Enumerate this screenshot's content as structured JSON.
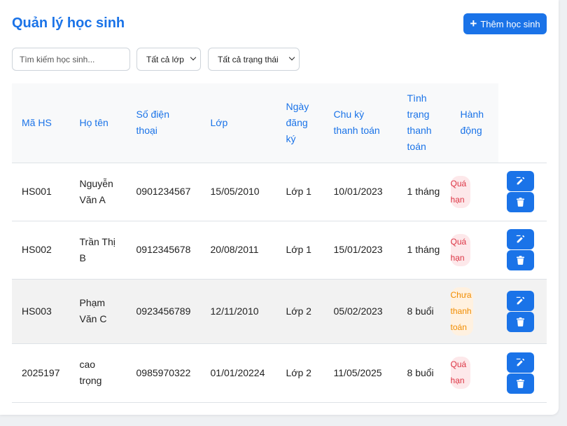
{
  "header": {
    "title": "Quản lý học sinh",
    "add_button_label": "Thêm học sinh"
  },
  "filters": {
    "search_placeholder": "Tìm kiếm học sinh...",
    "class_select": "Tất cả lớp",
    "status_select": "Tất cả trạng thái"
  },
  "table": {
    "headers": {
      "id": "Mã HS",
      "name": "Họ tên",
      "phone": "Số điện thoại",
      "class_col": "Lớp",
      "registered": "Ngày đăng ký",
      "cycle": "Chu kỳ thanh toán",
      "payment_status": "Tình trạng thanh toán",
      "action": "Hành động"
    },
    "rows": [
      {
        "id": "HS001",
        "name": "Nguyễn Văn A",
        "phone": "0901234567",
        "dob": "15/05/2010",
        "class_name": "Lớp 1",
        "registered": "10/01/2023",
        "cycle": "1 tháng",
        "status": "Quá hạn"
      },
      {
        "id": "HS002",
        "name": "Trần Thị B",
        "phone": "0912345678",
        "dob": "20/08/2011",
        "class_name": "Lớp 1",
        "registered": "15/01/2023",
        "cycle": "1 tháng",
        "status": "Quá hạn"
      },
      {
        "id": "HS003",
        "name": "Phạm Văn C",
        "phone": "0923456789",
        "dob": "12/11/2010",
        "class_name": "Lớp 2",
        "registered": "05/02/2023",
        "cycle": "8 buổi",
        "status": "Chưa thanh toán"
      },
      {
        "id": "2025197",
        "name": "cao trọng",
        "phone": "0985970322",
        "dob": "01/01/20224",
        "class_name": "Lớp 2",
        "registered": "11/05/2025",
        "cycle": "8 buổi",
        "status": "Quá hạn"
      }
    ]
  },
  "colors": {
    "primary": "#1a73e8",
    "overdue_text": "#dc3545",
    "overdue_bg": "#fde8ea",
    "unpaid_text": "#f08c00",
    "unpaid_bg": "#fff1e0"
  },
  "icons": {
    "add": "plus-icon",
    "edit": "edit-icon",
    "delete": "trash-icon"
  }
}
